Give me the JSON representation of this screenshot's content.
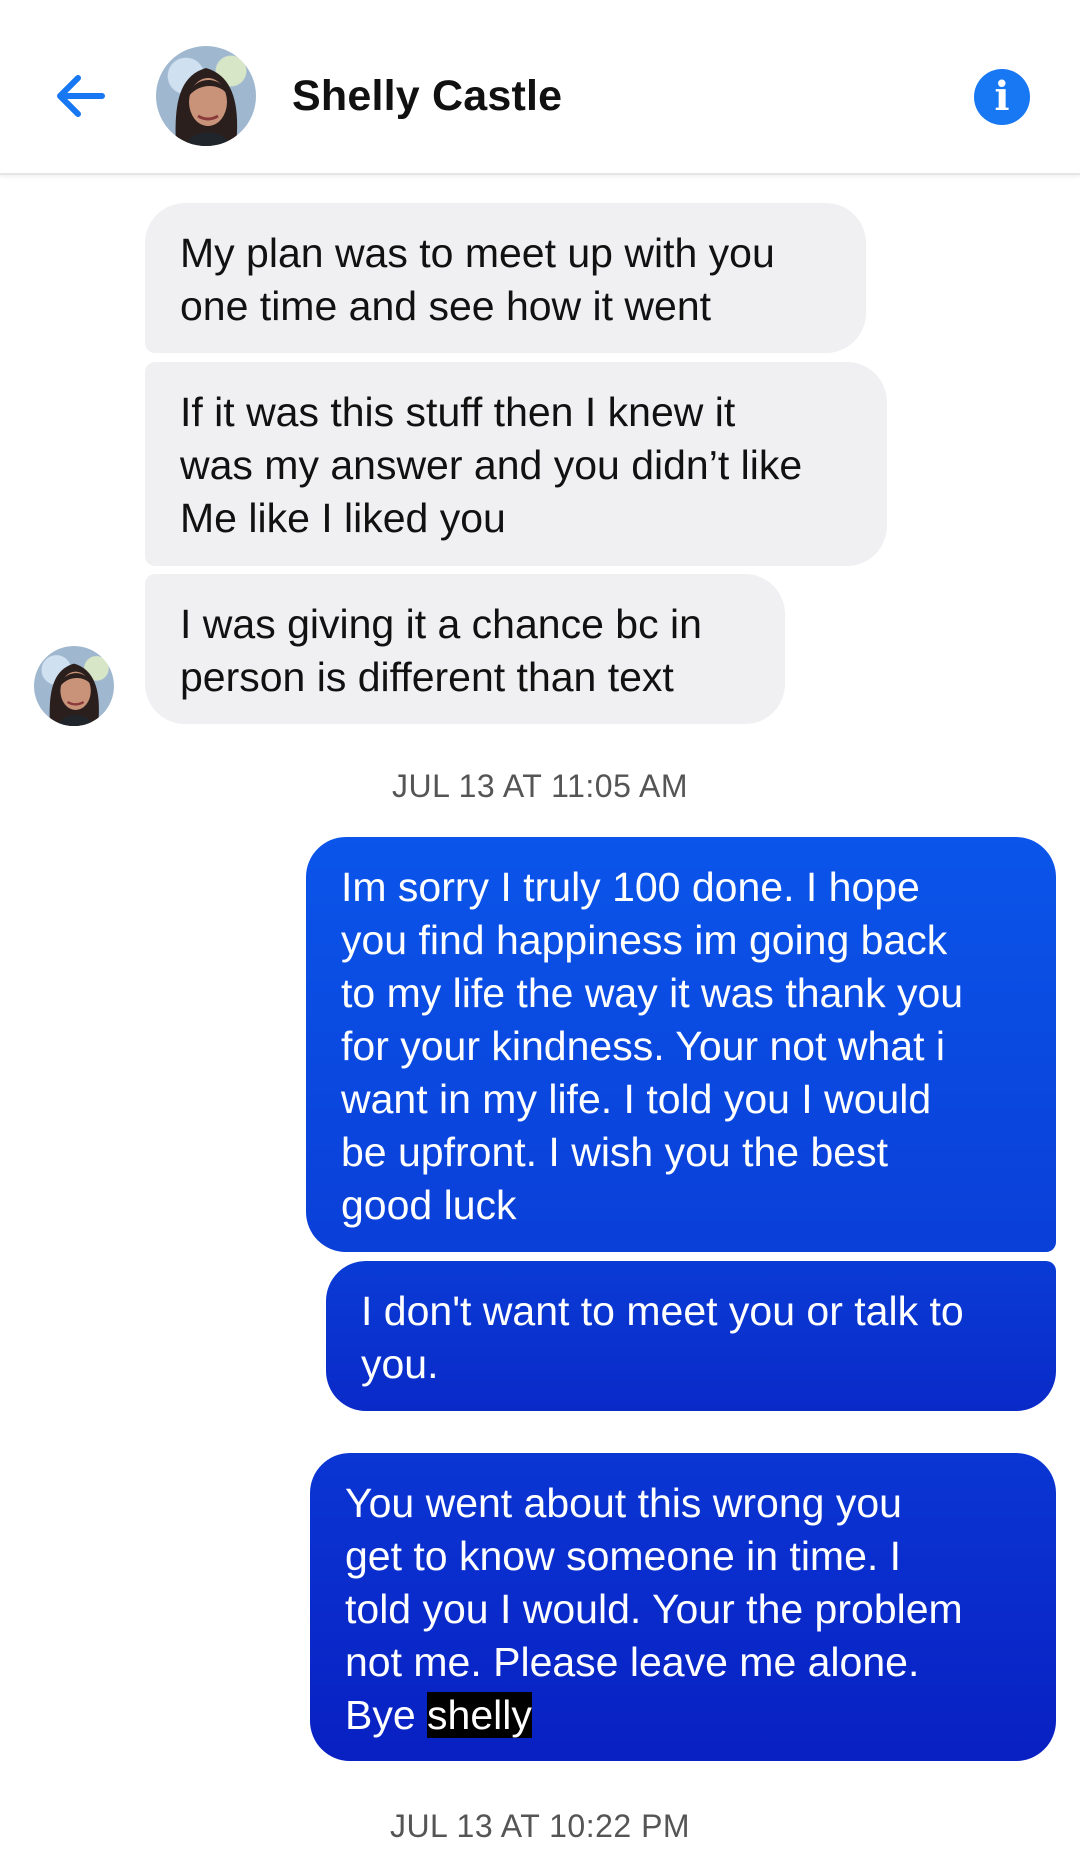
{
  "header": {
    "back_icon": "arrow-left-icon",
    "contact_name": "Shelly Castle",
    "info_icon": "info-icon",
    "accent_color": "#1877f2"
  },
  "messages": [
    {
      "direction": "incoming",
      "text": "My plan was to meet up with you\none time and see how it went"
    },
    {
      "direction": "incoming",
      "text": "If it was this stuff then I knew it\nwas my answer and you didn’t like\nMe like I liked you"
    },
    {
      "direction": "incoming",
      "text": "I was giving it a chance bc in\nperson is different than text"
    },
    {
      "direction": "outgoing",
      "text": "Im sorry I truly 100 done.  I hope\nyou find happiness im going back\nto my life the way it was thank you\nfor your kindness. Your not what i\nwant in my life.  I told you I would\nbe upfront. I wish you the best\ngood luck"
    },
    {
      "direction": "outgoing",
      "text": "I don't want to meet you or talk to\nyou."
    },
    {
      "direction": "outgoing",
      "text_before_highlight": "You went about this wrong you\nget to know someone in time. I\ntold you I would. Your the problem\nnot me. Please leave me alone.\nBye ",
      "highlighted": "shelly"
    }
  ],
  "timestamps": [
    "JUL 13 AT 11:05 AM",
    "JUL 13 AT 10:22 PM"
  ],
  "colors": {
    "incoming_bubble": "#f0f0f2",
    "outgoing_bubble_top": "#0b55ea",
    "outgoing_bubble_bottom": "#0920c2",
    "timestamp_text": "#555555"
  }
}
